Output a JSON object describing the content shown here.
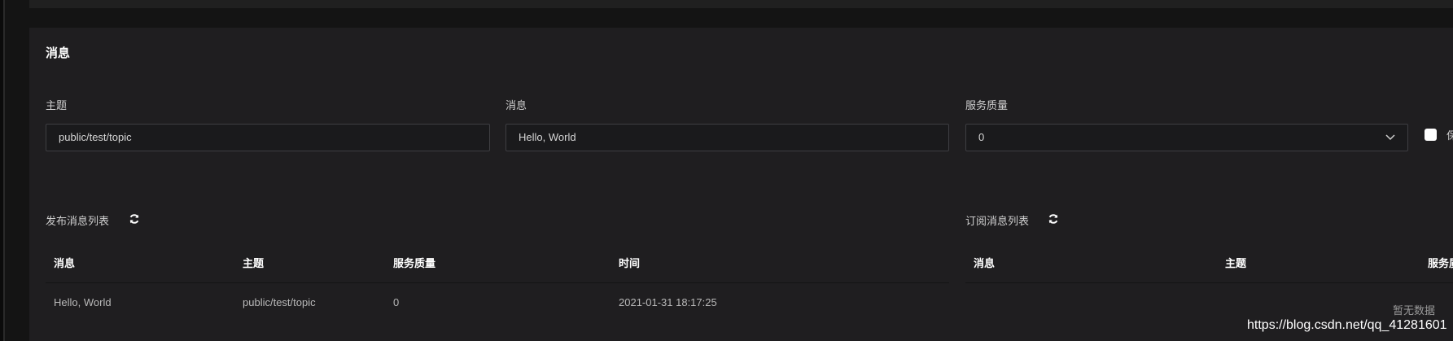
{
  "card": {
    "title": "消息"
  },
  "form": {
    "topic_label": "主题",
    "topic_value": "public/test/topic",
    "message_label": "消息",
    "message_value": "Hello, World",
    "qos_label": "服务质量",
    "qos_value": "0",
    "retain_label": "保"
  },
  "published": {
    "title": "发布消息列表",
    "columns": [
      "消息",
      "主题",
      "服务质量",
      "时间"
    ],
    "rows": [
      {
        "message": "Hello, World",
        "topic": "public/test/topic",
        "qos": "0",
        "time": "2021-01-31 18:17:25"
      }
    ]
  },
  "subscribed": {
    "title": "订阅消息列表",
    "columns": [
      "消息",
      "主题",
      "服务质"
    ],
    "empty_text": "暂无数据"
  },
  "watermark": "https://blog.csdn.net/qq_41281601",
  "icons": {
    "refresh": "refresh-icon",
    "dropdown": "chevron-down-icon"
  },
  "colors": {
    "background": "#141414",
    "card": "#1f1e20",
    "border": "#3e3e42"
  }
}
